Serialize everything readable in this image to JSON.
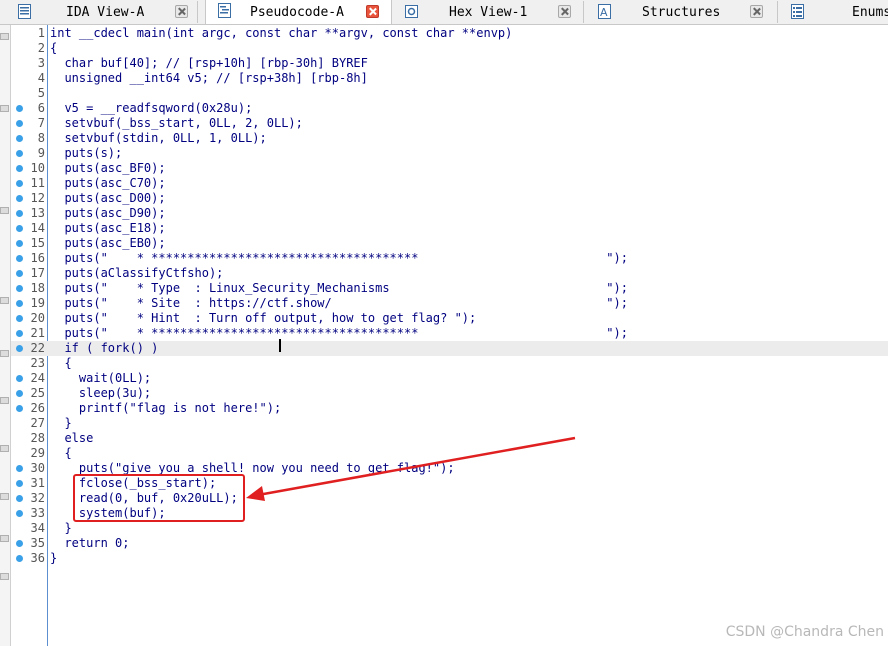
{
  "tabs": [
    {
      "label": "IDA View-A",
      "icon": "listing-icon",
      "active": false
    },
    {
      "label": "Pseudocode-A",
      "icon": "pseudocode-icon",
      "active": true
    },
    {
      "label": "Hex View-1",
      "icon": "hex-icon",
      "active": false
    },
    {
      "label": "Structures",
      "icon": "structures-icon",
      "active": false
    },
    {
      "label": "Enums",
      "icon": "enums-icon",
      "active": false
    }
  ],
  "code": [
    {
      "n": "1",
      "dot": false,
      "text": "int __cdecl main(int argc, const char **argv, const char **envp)"
    },
    {
      "n": "2",
      "dot": false,
      "text": "{"
    },
    {
      "n": "3",
      "dot": false,
      "text": "  char buf[40]; // [rsp+10h] [rbp-30h] BYREF"
    },
    {
      "n": "4",
      "dot": false,
      "text": "  unsigned __int64 v5; // [rsp+38h] [rbp-8h]"
    },
    {
      "n": "5",
      "dot": false,
      "text": ""
    },
    {
      "n": "6",
      "dot": true,
      "text": "  v5 = __readfsqword(0x28u);"
    },
    {
      "n": "7",
      "dot": true,
      "text": "  setvbuf(_bss_start, 0LL, 2, 0LL);"
    },
    {
      "n": "8",
      "dot": true,
      "text": "  setvbuf(stdin, 0LL, 1, 0LL);"
    },
    {
      "n": "9",
      "dot": true,
      "text": "  puts(s);"
    },
    {
      "n": "10",
      "dot": true,
      "text": "  puts(asc_BF0);"
    },
    {
      "n": "11",
      "dot": true,
      "text": "  puts(asc_C70);"
    },
    {
      "n": "12",
      "dot": true,
      "text": "  puts(asc_D00);"
    },
    {
      "n": "13",
      "dot": true,
      "text": "  puts(asc_D90);"
    },
    {
      "n": "14",
      "dot": true,
      "text": "  puts(asc_E18);"
    },
    {
      "n": "15",
      "dot": true,
      "text": "  puts(asc_EB0);"
    },
    {
      "n": "16",
      "dot": true,
      "text": "  puts(\"    * *************************************                          \");"
    },
    {
      "n": "17",
      "dot": true,
      "text": "  puts(aClassifyCtfsho);"
    },
    {
      "n": "18",
      "dot": true,
      "text": "  puts(\"    * Type  : Linux_Security_Mechanisms                              \");"
    },
    {
      "n": "19",
      "dot": true,
      "text": "  puts(\"    * Site  : https://ctf.show/                                      \");"
    },
    {
      "n": "20",
      "dot": true,
      "text": "  puts(\"    * Hint  : Turn off output, how to get flag? \");"
    },
    {
      "n": "21",
      "dot": true,
      "text": "  puts(\"    * *************************************                          \");"
    },
    {
      "n": "22",
      "dot": true,
      "text": "  if ( fork() )",
      "hl": true
    },
    {
      "n": "23",
      "dot": false,
      "text": "  {"
    },
    {
      "n": "24",
      "dot": true,
      "text": "    wait(0LL);"
    },
    {
      "n": "25",
      "dot": true,
      "text": "    sleep(3u);"
    },
    {
      "n": "26",
      "dot": true,
      "text": "    printf(\"flag is not here!\");"
    },
    {
      "n": "27",
      "dot": false,
      "text": "  }"
    },
    {
      "n": "28",
      "dot": false,
      "text": "  else"
    },
    {
      "n": "29",
      "dot": false,
      "text": "  {"
    },
    {
      "n": "30",
      "dot": true,
      "text": "    puts(\"give you a shell! now you need to get flag!\");"
    },
    {
      "n": "31",
      "dot": true,
      "text": "    fclose(_bss_start);"
    },
    {
      "n": "32",
      "dot": true,
      "text": "    read(0, buf, 0x20uLL);"
    },
    {
      "n": "33",
      "dot": true,
      "text": "    system(buf);"
    },
    {
      "n": "34",
      "dot": false,
      "text": "  }"
    },
    {
      "n": "35",
      "dot": true,
      "text": "  return 0;"
    },
    {
      "n": "36",
      "dot": true,
      "text": "}"
    }
  ],
  "watermark": "CSDN @Chandra Chen",
  "colors": {
    "accent_dot": "#3aa0e8",
    "code_text": "#000080",
    "annotation": "#e02020"
  }
}
